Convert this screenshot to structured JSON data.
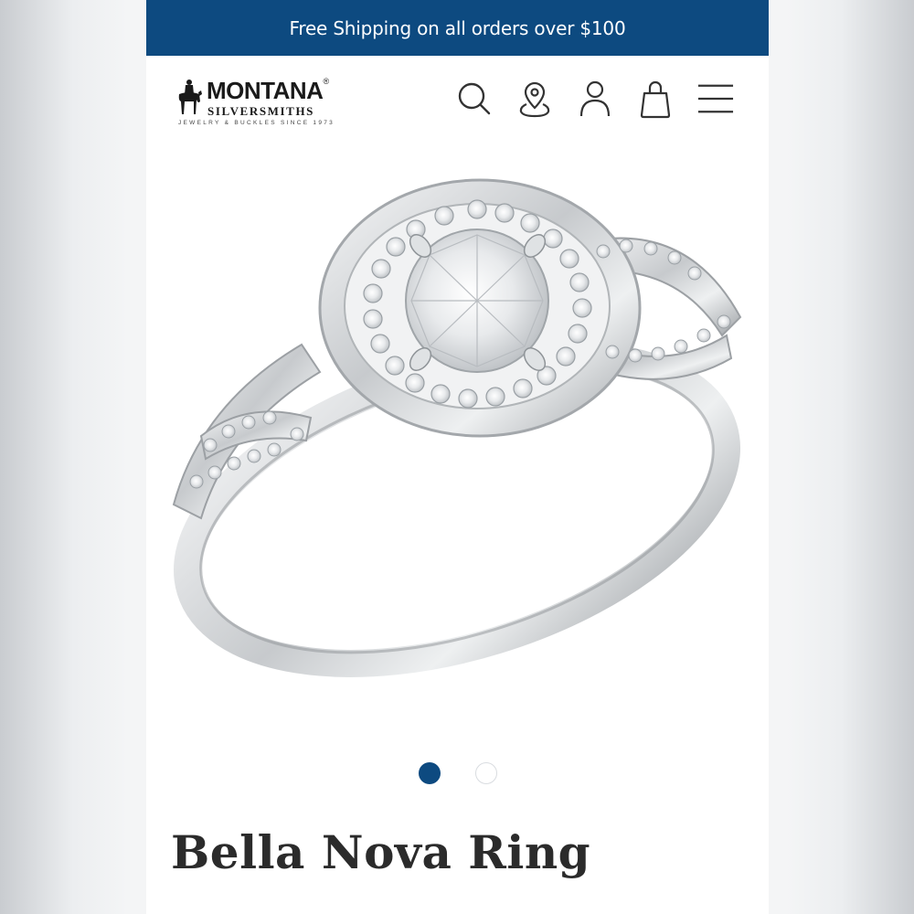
{
  "promo": {
    "text": "Free Shipping on all orders over $100"
  },
  "brand": {
    "name": "MONTANA",
    "registered": "®",
    "sub": "SILVERSMITHS",
    "tagline": "JEWELRY & BUCKLES SINCE 1973"
  },
  "header_icons": [
    "search-icon",
    "store-locator-icon",
    "account-icon",
    "cart-bag-icon",
    "menu-icon"
  ],
  "carousel": {
    "total": 2,
    "active": 1
  },
  "product": {
    "title": "Bella Nova Ring"
  },
  "colors": {
    "brand_blue": "#0d4a80",
    "text_dark": "#2b2b2b"
  }
}
